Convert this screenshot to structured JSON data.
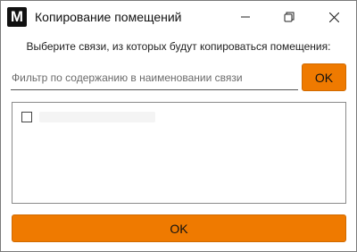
{
  "window": {
    "app_icon_letter": "M",
    "title": "Копирование помещений",
    "controls": {
      "minimize_icon": "minimize-icon",
      "maximize_icon": "restore-icon",
      "close_icon": "close-icon"
    }
  },
  "dialog": {
    "prompt": "Выберите связи, из которых будут копироваться помещения:",
    "filter": {
      "placeholder": "Фильтр по содержанию в наименовании связи",
      "value": ""
    },
    "filter_ok_label": "OK",
    "links": [
      {
        "checked": false,
        "label": ""
      }
    ],
    "confirm_label": "OK"
  },
  "colors": {
    "accent": "#ef7a00",
    "border": "#8a8a8a"
  }
}
